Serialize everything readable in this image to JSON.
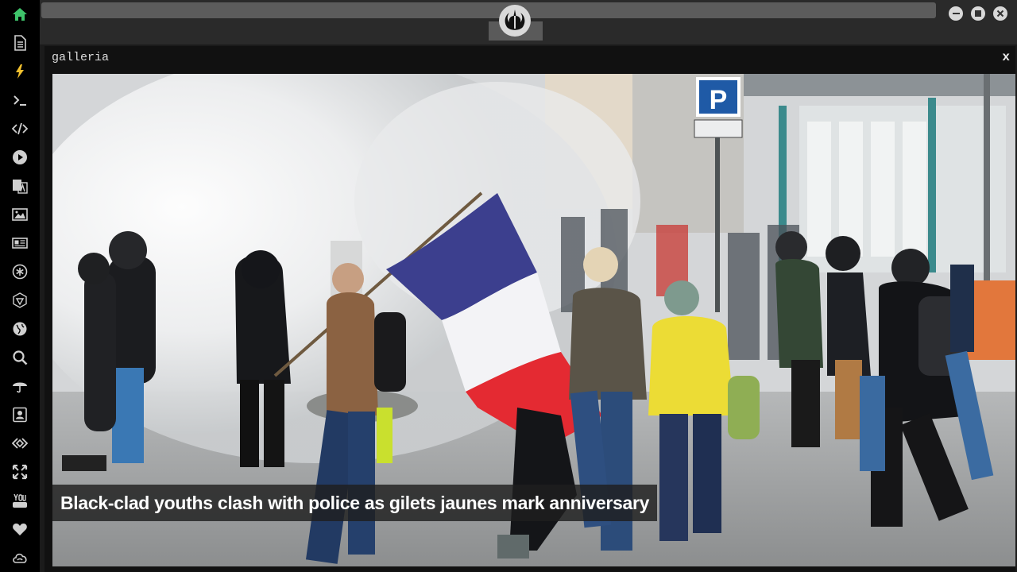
{
  "sidebar": {
    "items": [
      {
        "icon": "home-icon",
        "color": "#3fc46b"
      },
      {
        "icon": "document-icon",
        "color": "#d0d0d0"
      },
      {
        "icon": "lightning-icon",
        "color": "#f2c12e"
      },
      {
        "icon": "terminal-icon",
        "color": "#d0d0d0"
      },
      {
        "icon": "code-icon",
        "color": "#d0d0d0"
      },
      {
        "icon": "play-icon",
        "color": "#d0d0d0"
      },
      {
        "icon": "translate-icon",
        "color": "#d0d0d0"
      },
      {
        "icon": "image-icon",
        "color": "#d0d0d0"
      },
      {
        "icon": "news-icon",
        "color": "#d0d0d0"
      },
      {
        "icon": "asterisk-icon",
        "color": "#d0d0d0"
      },
      {
        "icon": "hexagon-icon",
        "color": "#d0d0d0"
      },
      {
        "icon": "globe-icon",
        "color": "#d0d0d0"
      },
      {
        "icon": "search-icon",
        "color": "#d0d0d0"
      },
      {
        "icon": "umbrella-icon",
        "color": "#d0d0d0"
      },
      {
        "icon": "contact-icon",
        "color": "#d0d0d0"
      },
      {
        "icon": "diamond-code-icon",
        "color": "#d0d0d0"
      },
      {
        "icon": "expand-icon",
        "color": "#d0d0d0"
      },
      {
        "icon": "youtube-icon",
        "color": "#d0d0d0"
      },
      {
        "icon": "heart-icon",
        "color": "#d0d0d0"
      },
      {
        "icon": "cloud-icon",
        "color": "#d0d0d0"
      }
    ]
  },
  "window": {
    "logo_icon": "rebel-alliance-icon",
    "controls": [
      "minimize-icon",
      "maximize-icon",
      "close-icon"
    ]
  },
  "panel": {
    "title": "galleria",
    "close_label": "x"
  },
  "gallery": {
    "caption": "Black-clad youths clash with police as gilets jaunes mark anniversary"
  }
}
